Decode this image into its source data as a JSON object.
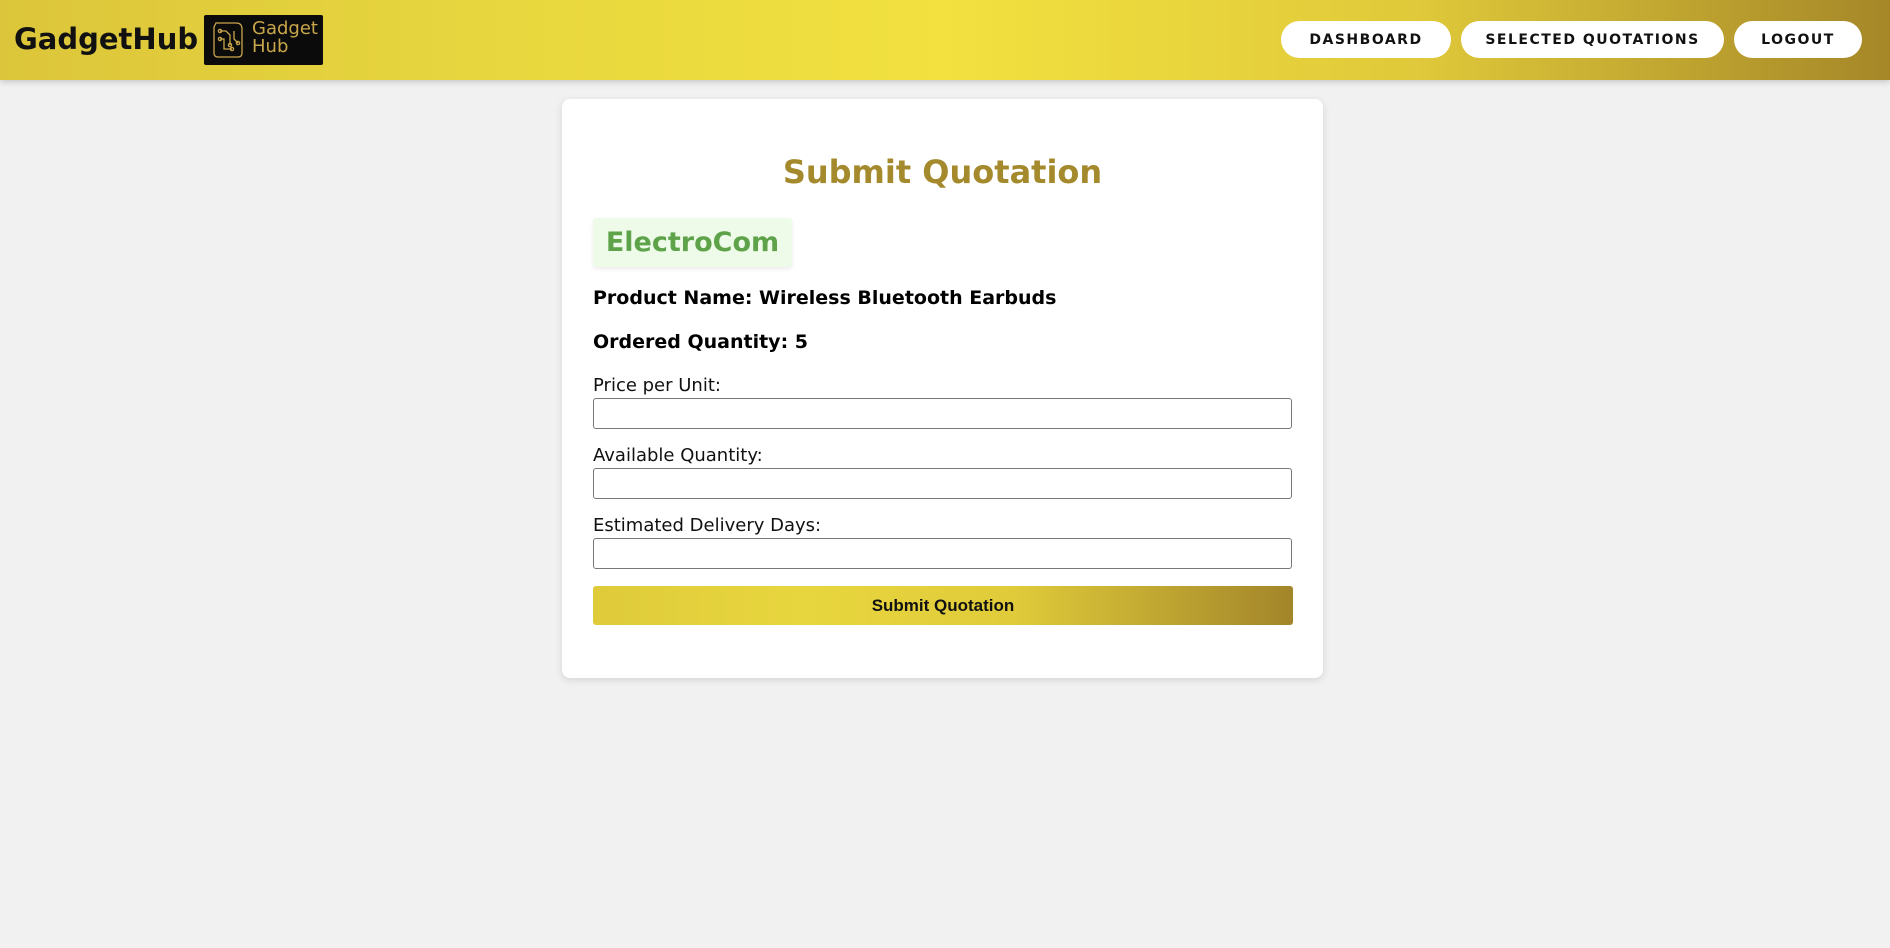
{
  "header": {
    "brand": "GadgetHub",
    "logo": {
      "text_line1": "Gadget",
      "text_line2": "Hub",
      "icon": "circuit-board-icon"
    },
    "nav": {
      "dashboard": "DASHBOARD",
      "selected_quotations": "SELECTED QUOTATIONS",
      "logout": "LOGOUT"
    }
  },
  "form": {
    "title": "Submit Quotation",
    "company": "ElectroCom",
    "product_name": "Product Name: Wireless Bluetooth Earbuds",
    "ordered_quantity": "Ordered Quantity: 5",
    "fields": {
      "price_label": "Price per Unit:",
      "price_value": "",
      "available_label": "Available Quantity:",
      "available_value": "",
      "delivery_label": "Estimated Delivery Days:",
      "delivery_value": ""
    },
    "submit_label": "Submit Quotation"
  },
  "colors": {
    "accent_gold": "#a48a2c",
    "company_green": "#5ea24a",
    "header_yellow": "#f2e13f"
  }
}
